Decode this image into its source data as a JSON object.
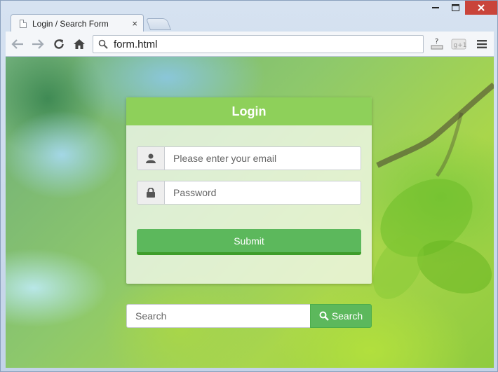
{
  "browser": {
    "tab_title": "Login / Search Form",
    "tab_close": "×",
    "window_controls": {
      "minimize": "▬",
      "maximize": "☐",
      "close": "✕"
    },
    "address_url": "form.html",
    "icons": {
      "back": "←",
      "forward": "→",
      "reload": "⟳",
      "home": "⌂",
      "menu": "≡",
      "help": "?",
      "gplus": "g+1"
    }
  },
  "login": {
    "title": "Login",
    "email_placeholder": "Please enter your email",
    "password_placeholder": "Password",
    "submit_label": "Submit"
  },
  "search": {
    "placeholder": "Search",
    "button_label": "Search"
  },
  "colors": {
    "header_green": "#8ed05a",
    "button_green": "#5cb85c",
    "close_red": "#c9443a"
  }
}
